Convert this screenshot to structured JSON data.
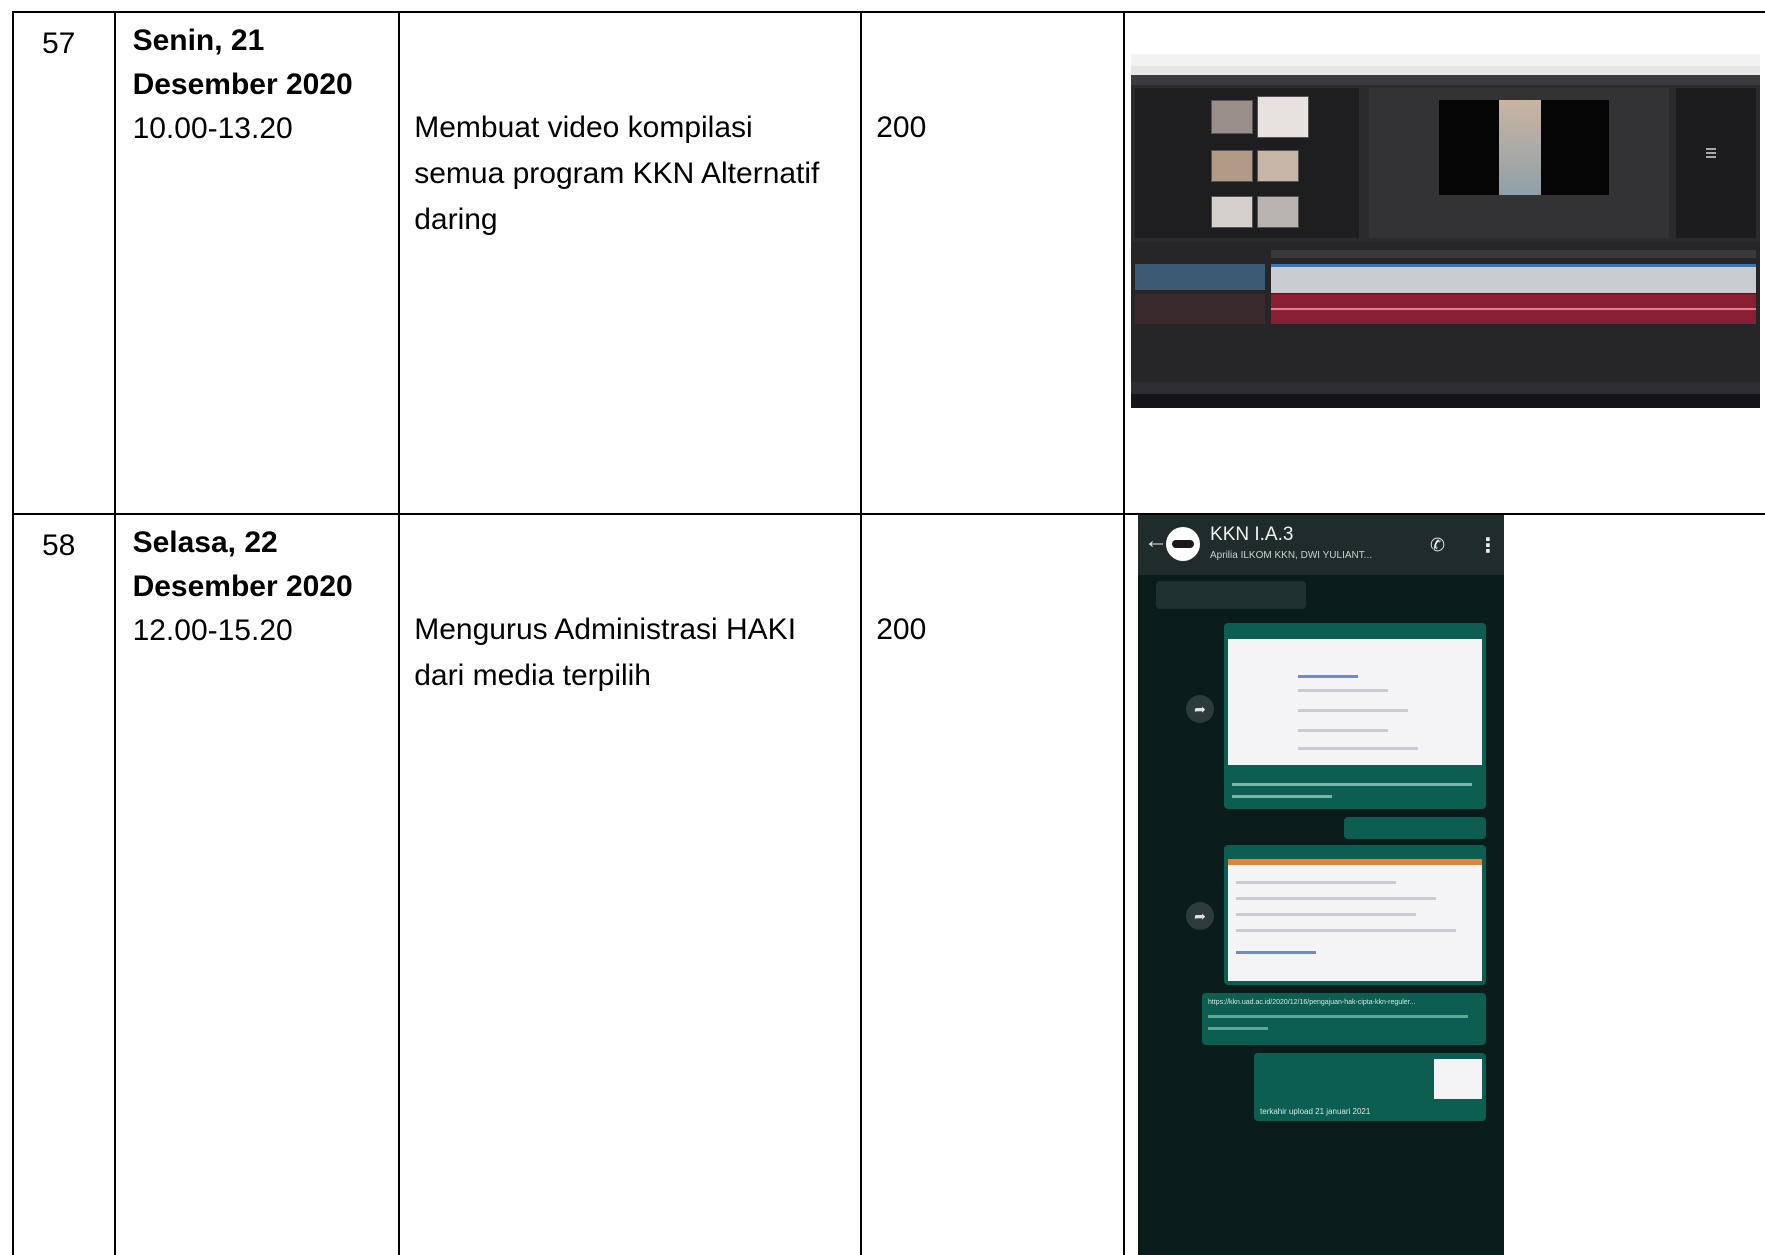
{
  "rows": [
    {
      "no": "57",
      "day": "Senin, 21",
      "date": "Desember 2020",
      "time": "10.00-13.20",
      "activity": "Membuat video kompilasi semua program KKN Alternatif daring",
      "value": "200",
      "screenshot_icon": "video-editor-screenshot"
    },
    {
      "no": "58",
      "day": "Selasa, 22",
      "date": "Desember 2020",
      "time": "12.00-15.20",
      "activity": "Mengurus Administrasi HAKI dari media terpilih",
      "value": "200",
      "screenshot_icon": "chat-screenshot"
    }
  ],
  "whatsapp": {
    "group_name": "KKN I.A.3",
    "participants": "Aprilia ILKOM KKN, DWI YULIANT...",
    "message_1": "https://kkn.uad.ac.id/2020/12/16/pengajuan-hak-cipta-kkn-reguler...",
    "message_2": "terkahir upload 21 januari 2021"
  }
}
